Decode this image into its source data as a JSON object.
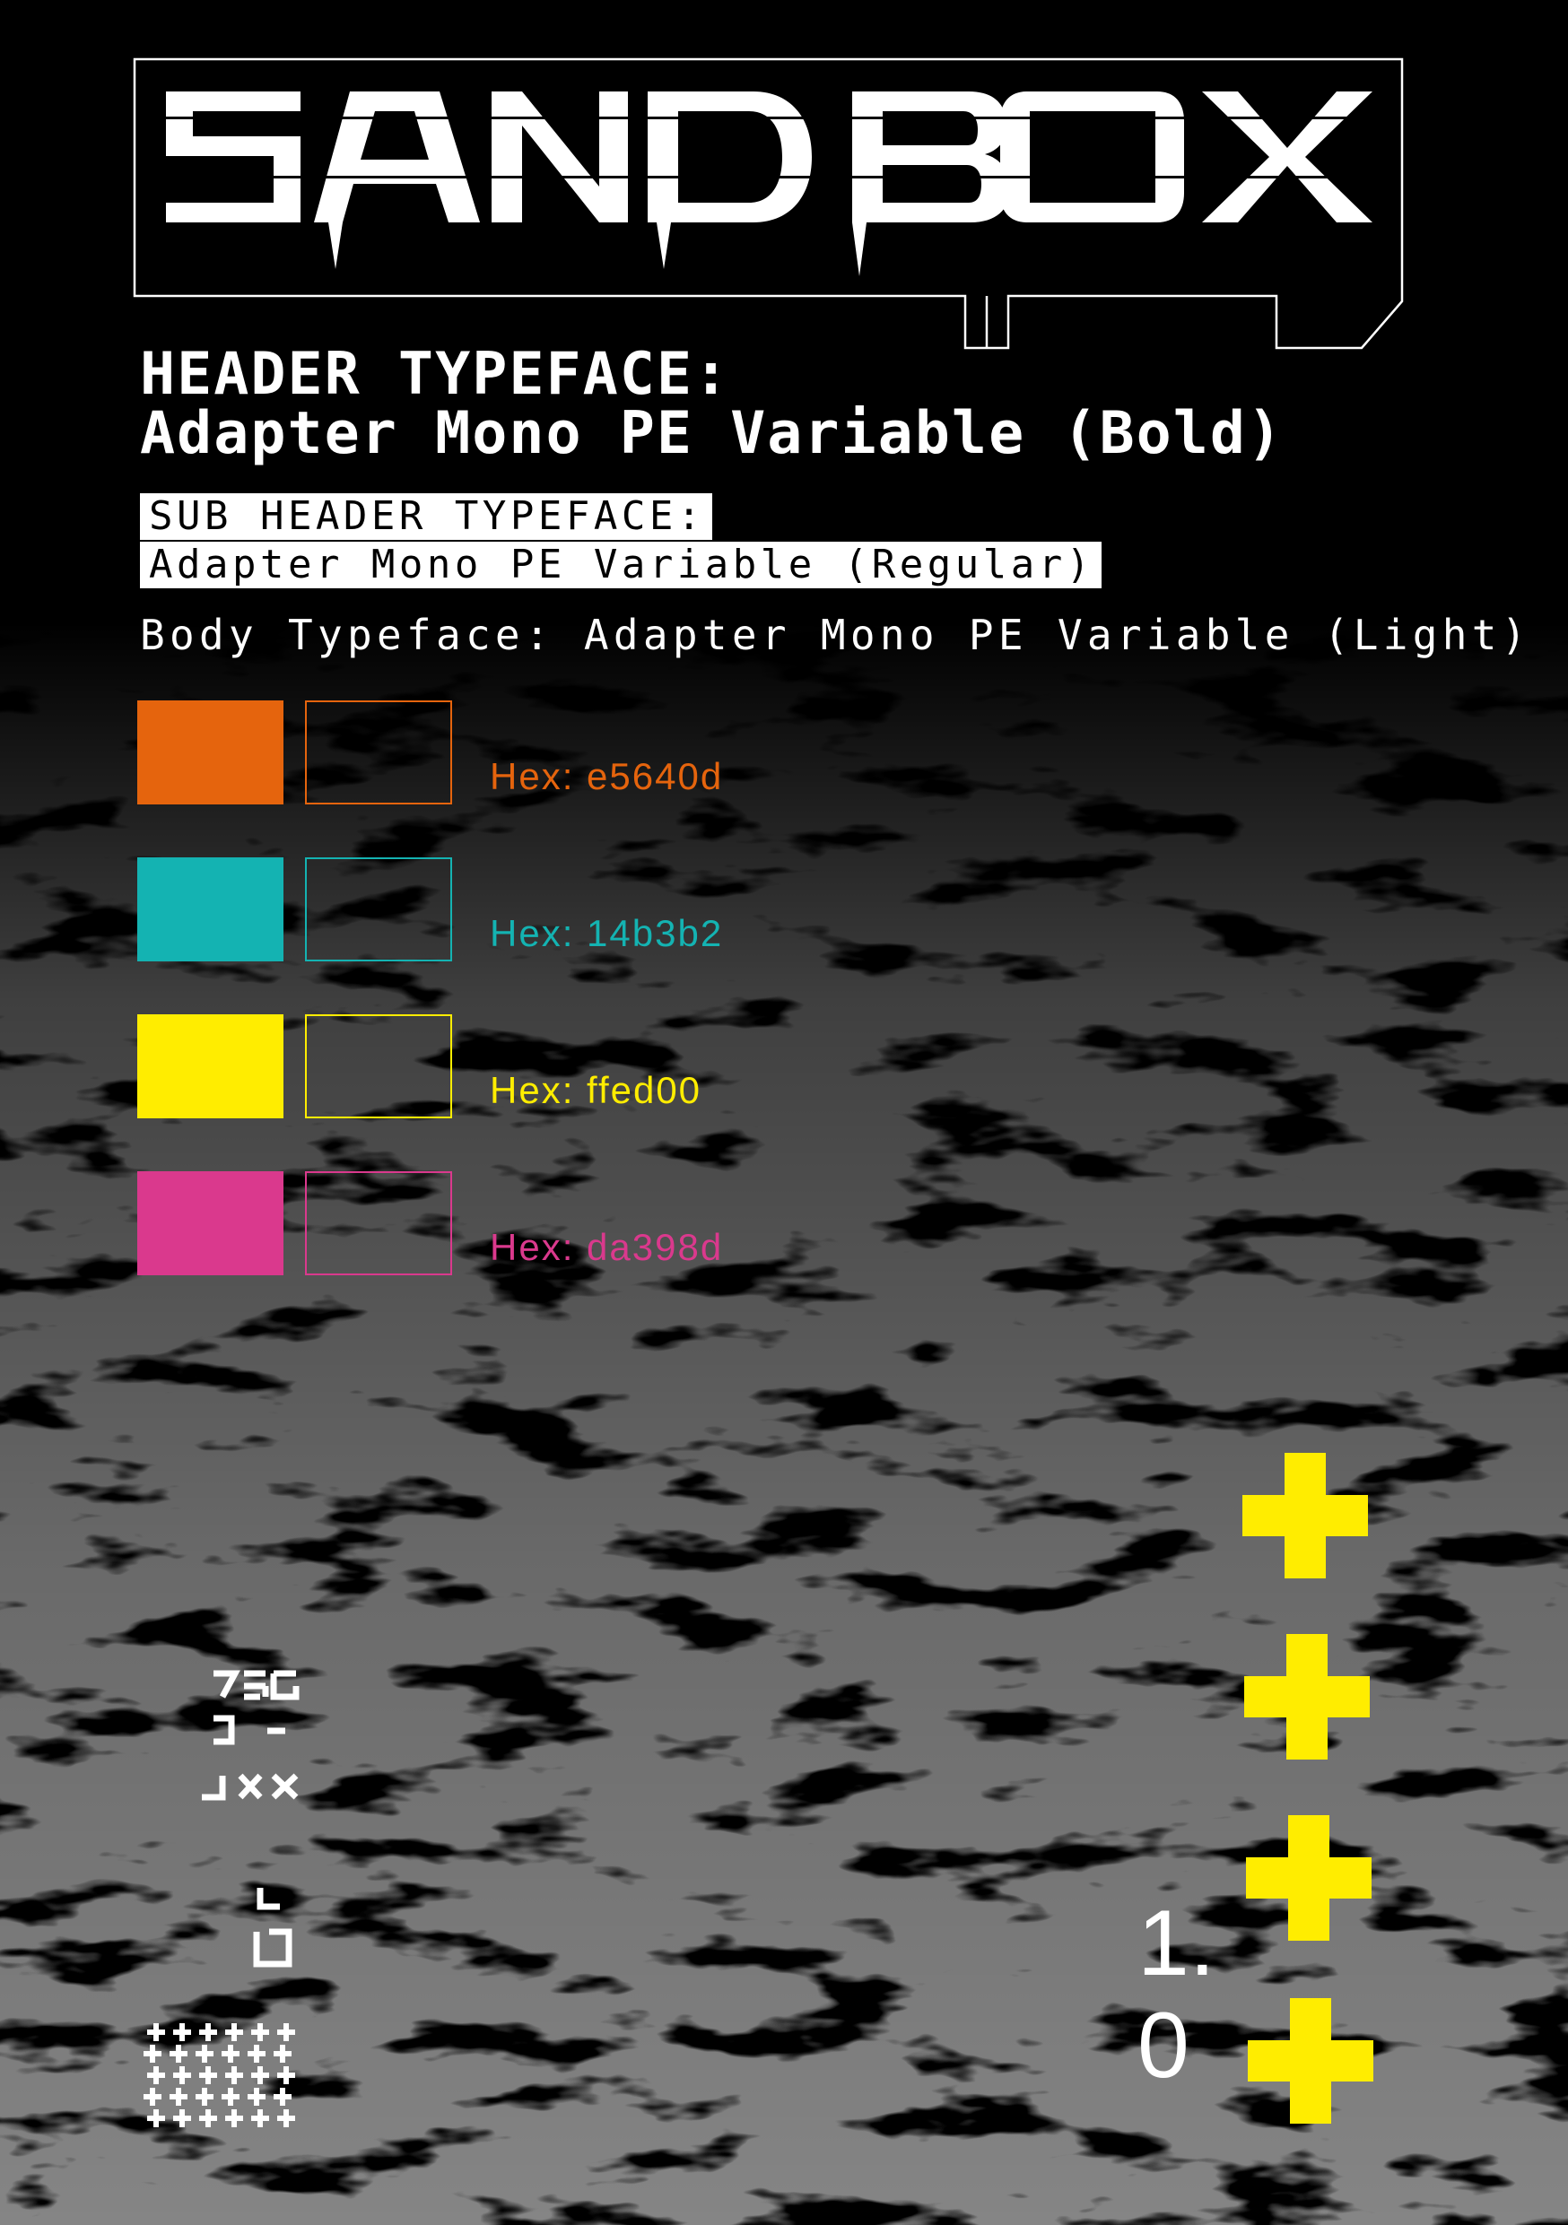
{
  "logo": {
    "text": "SANDBOX"
  },
  "header": {
    "label": "HEADER TYPEFACE:",
    "value": "Adapter Mono PE Variable (Bold)"
  },
  "sub_header": {
    "label": "SUB HEADER TYPEFACE:",
    "value": "Adapter Mono PE Variable (Regular)"
  },
  "body_typeface": "Body Typeface: Adapter Mono PE Variable (Light)",
  "palette": [
    {
      "hex_label": "Hex: e5640d",
      "color": "#e5640d"
    },
    {
      "hex_label": "Hex: 14b3b2",
      "color": "#14b3b2"
    },
    {
      "hex_label": "Hex: ffed00",
      "color": "#ffed00"
    },
    {
      "hex_label": "Hex: da398d",
      "color": "#da398d"
    }
  ],
  "version": {
    "line1": "1.",
    "line2": "0"
  },
  "accent_plus_color": "#ffed00",
  "decorative": {
    "glyph_cluster_icon": "glitch-glyphs-icon",
    "plus_grid_icon": "plus-grid-icon"
  }
}
